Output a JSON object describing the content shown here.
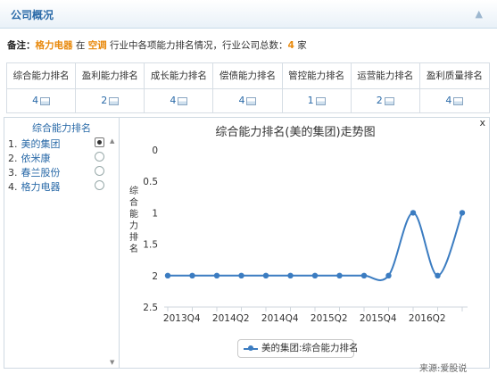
{
  "header": {
    "title": "公司概况"
  },
  "note": {
    "label": "备注：",
    "company": "格力电器",
    "in": "在",
    "industry": "空调",
    "mid": "行业中各项能力排名情况，行业公司总数：",
    "count": "4",
    "unit": "家"
  },
  "rank_table": {
    "headers": [
      "综合能力排名",
      "盈利能力排名",
      "成长能力排名",
      "偿债能力排名",
      "管控能力排名",
      "运营能力排名",
      "盈利质量排名"
    ],
    "values": [
      "4",
      "2",
      "4",
      "4",
      "1",
      "2",
      "4"
    ]
  },
  "left_panel": {
    "title": "综合能力排名",
    "items": [
      {
        "num": "1.",
        "name": "美的集团",
        "selected": true
      },
      {
        "num": "2.",
        "name": "依米康",
        "selected": false
      },
      {
        "num": "3.",
        "name": "春兰股份",
        "selected": false
      },
      {
        "num": "4.",
        "name": "格力电器",
        "selected": false
      }
    ]
  },
  "close_label": "x",
  "source": "来源:爱股说",
  "chart_data": {
    "type": "line",
    "title": "综合能力排名(美的集团)走势图",
    "ylabel": "综合能力排名",
    "ylim": [
      2.5,
      0
    ],
    "y_reversed": true,
    "yticks": [
      "0",
      "0.5",
      "1",
      "1.5",
      "2",
      "2.5"
    ],
    "x_tick_labels": [
      "2013Q4",
      "2014Q2",
      "2014Q4",
      "2015Q2",
      "2015Q4",
      "2016Q2"
    ],
    "series": [
      {
        "name": "美的集团:综合能力排名",
        "values": [
          2,
          2,
          2,
          2,
          2,
          2,
          2,
          2,
          2,
          2,
          1,
          2,
          1
        ]
      }
    ],
    "color": "#3b7cc1",
    "smooth": true,
    "legend": "bottom"
  }
}
